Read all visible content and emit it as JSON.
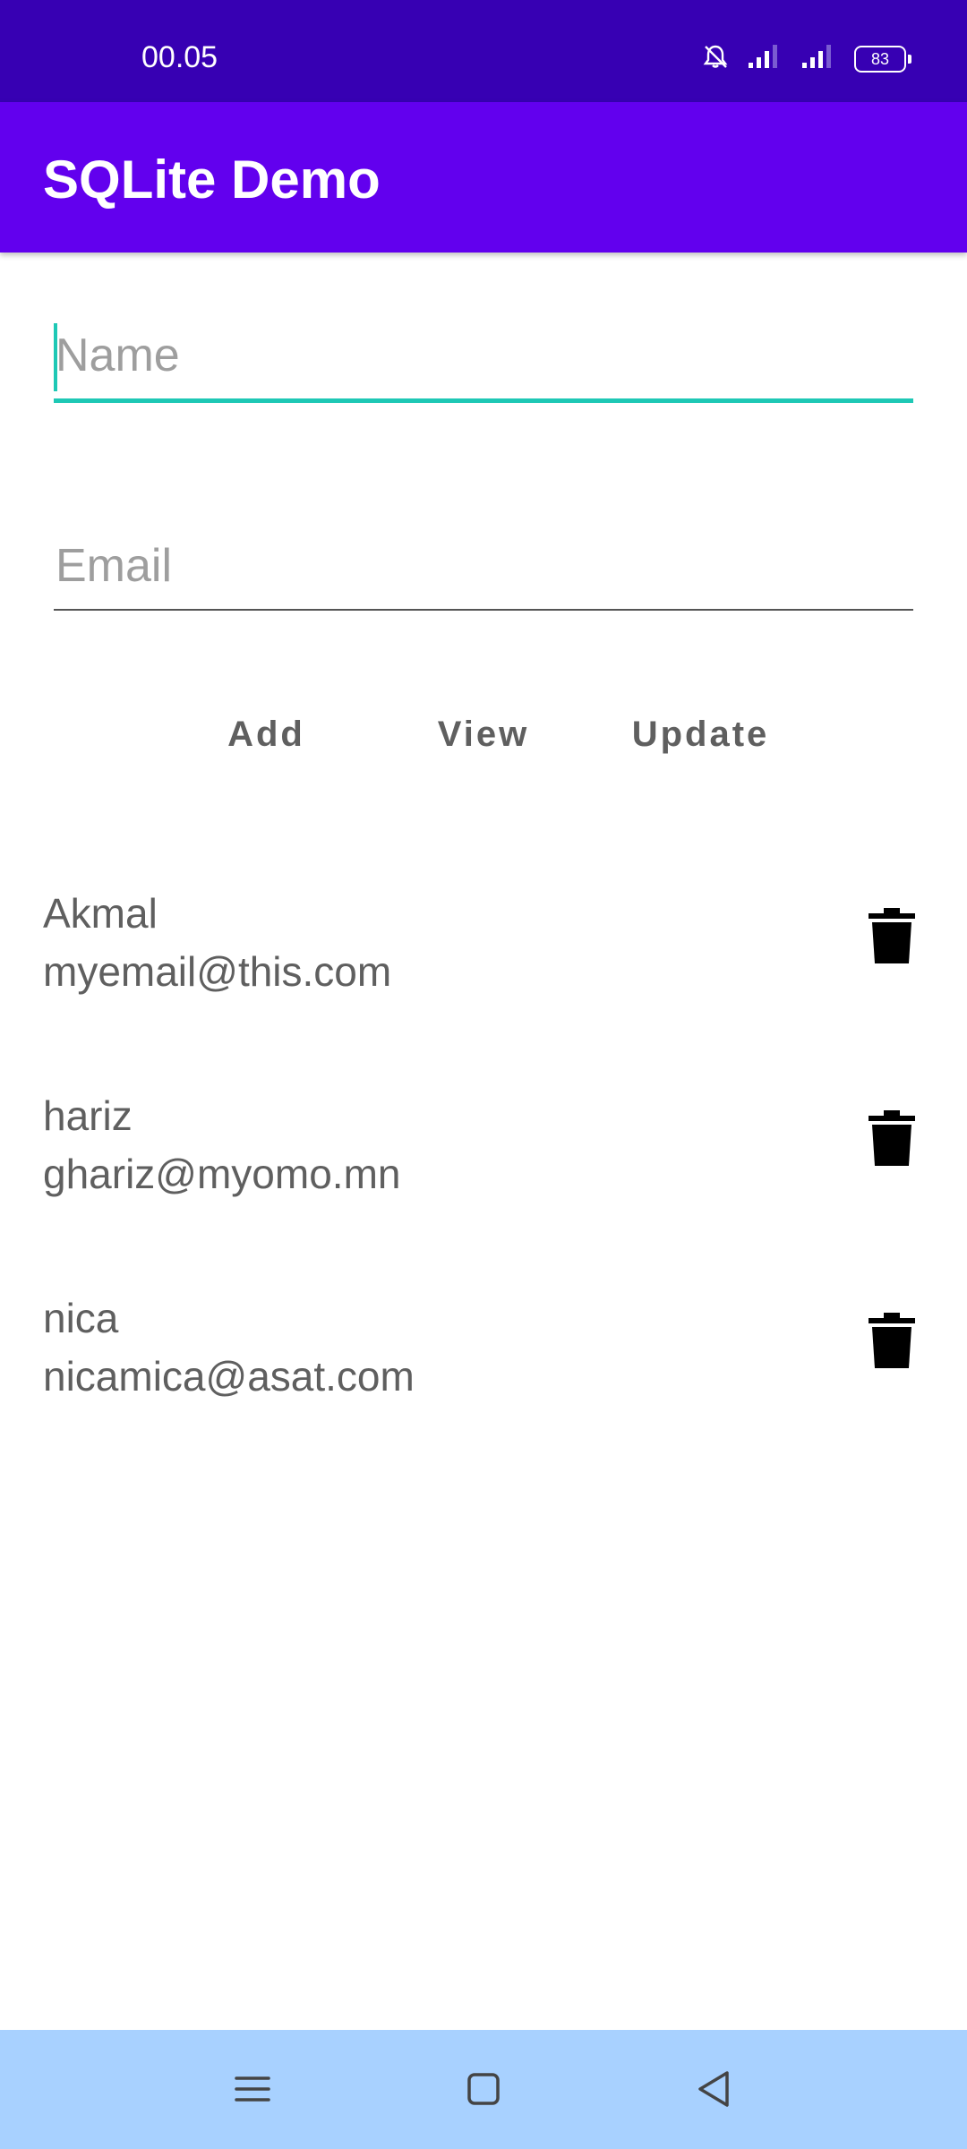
{
  "status_bar": {
    "time": "00.05",
    "battery": "83",
    "icons": [
      "bell-off-icon",
      "signal-icon",
      "signal-icon",
      "battery-icon"
    ]
  },
  "app_bar": {
    "title": "SQLite Demo"
  },
  "form": {
    "name_placeholder": "Name",
    "email_placeholder": "Email"
  },
  "buttons": {
    "add": "Add",
    "view": "View",
    "update": "Update"
  },
  "records": [
    {
      "name": "Akmal",
      "email": "myemail@this.com"
    },
    {
      "name": "hariz",
      "email": "ghariz@myomo.mn"
    },
    {
      "name": "nica",
      "email": "nicamica@asat.com"
    }
  ],
  "nav_bar": {
    "icons": [
      "menu-icon",
      "home-icon",
      "back-icon"
    ]
  },
  "colors": {
    "status_bar": "#3700b3",
    "app_bar": "#6200ee",
    "focus_accent": "#1ec8b5",
    "nav_bar": "#a8d1ff"
  }
}
